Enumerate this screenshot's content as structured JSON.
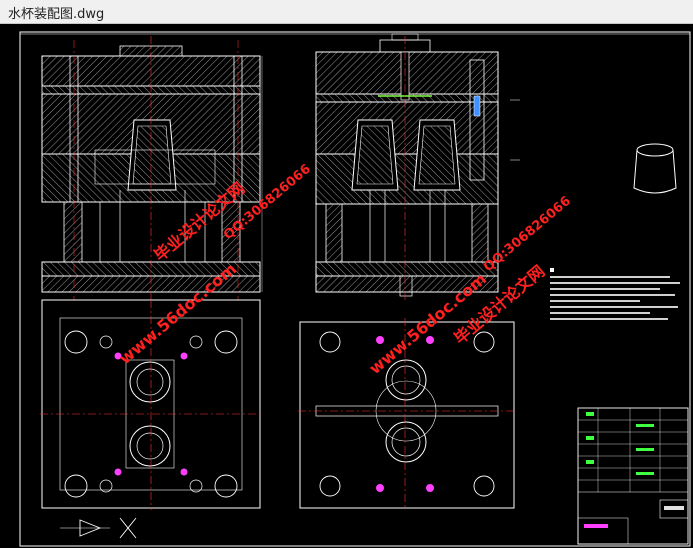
{
  "window": {
    "title": "水杯装配图.dwg"
  },
  "watermarks": {
    "left": {
      "site": "www.56doc.com",
      "brand": "毕业设计论文网",
      "qq": "QQ:306826066"
    },
    "right": {
      "site": "www.56doc.com",
      "brand": "毕业设计论文网",
      "qq": "QQ:306826066"
    }
  },
  "colors": {
    "background": "#000000",
    "lines": "#ffffff",
    "center_lines": "#ff3030",
    "hatch": "#c8c8c8",
    "highlight": "#ff40ff",
    "watermark": "#ff2020"
  }
}
